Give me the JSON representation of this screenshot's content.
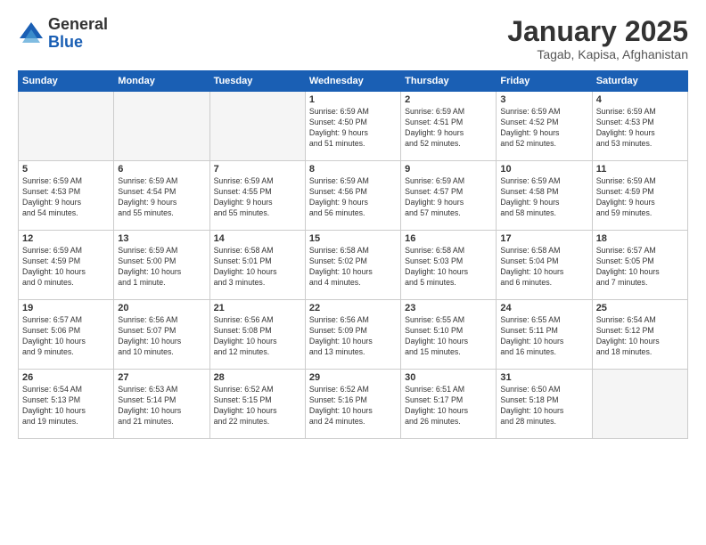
{
  "logo": {
    "general": "General",
    "blue": "Blue"
  },
  "title": "January 2025",
  "subtitle": "Tagab, Kapisa, Afghanistan",
  "days_of_week": [
    "Sunday",
    "Monday",
    "Tuesday",
    "Wednesday",
    "Thursday",
    "Friday",
    "Saturday"
  ],
  "weeks": [
    [
      {
        "day": "",
        "info": ""
      },
      {
        "day": "",
        "info": ""
      },
      {
        "day": "",
        "info": ""
      },
      {
        "day": "1",
        "info": "Sunrise: 6:59 AM\nSunset: 4:50 PM\nDaylight: 9 hours\nand 51 minutes."
      },
      {
        "day": "2",
        "info": "Sunrise: 6:59 AM\nSunset: 4:51 PM\nDaylight: 9 hours\nand 52 minutes."
      },
      {
        "day": "3",
        "info": "Sunrise: 6:59 AM\nSunset: 4:52 PM\nDaylight: 9 hours\nand 52 minutes."
      },
      {
        "day": "4",
        "info": "Sunrise: 6:59 AM\nSunset: 4:53 PM\nDaylight: 9 hours\nand 53 minutes."
      }
    ],
    [
      {
        "day": "5",
        "info": "Sunrise: 6:59 AM\nSunset: 4:53 PM\nDaylight: 9 hours\nand 54 minutes."
      },
      {
        "day": "6",
        "info": "Sunrise: 6:59 AM\nSunset: 4:54 PM\nDaylight: 9 hours\nand 55 minutes."
      },
      {
        "day": "7",
        "info": "Sunrise: 6:59 AM\nSunset: 4:55 PM\nDaylight: 9 hours\nand 55 minutes."
      },
      {
        "day": "8",
        "info": "Sunrise: 6:59 AM\nSunset: 4:56 PM\nDaylight: 9 hours\nand 56 minutes."
      },
      {
        "day": "9",
        "info": "Sunrise: 6:59 AM\nSunset: 4:57 PM\nDaylight: 9 hours\nand 57 minutes."
      },
      {
        "day": "10",
        "info": "Sunrise: 6:59 AM\nSunset: 4:58 PM\nDaylight: 9 hours\nand 58 minutes."
      },
      {
        "day": "11",
        "info": "Sunrise: 6:59 AM\nSunset: 4:59 PM\nDaylight: 9 hours\nand 59 minutes."
      }
    ],
    [
      {
        "day": "12",
        "info": "Sunrise: 6:59 AM\nSunset: 4:59 PM\nDaylight: 10 hours\nand 0 minutes."
      },
      {
        "day": "13",
        "info": "Sunrise: 6:59 AM\nSunset: 5:00 PM\nDaylight: 10 hours\nand 1 minute."
      },
      {
        "day": "14",
        "info": "Sunrise: 6:58 AM\nSunset: 5:01 PM\nDaylight: 10 hours\nand 3 minutes."
      },
      {
        "day": "15",
        "info": "Sunrise: 6:58 AM\nSunset: 5:02 PM\nDaylight: 10 hours\nand 4 minutes."
      },
      {
        "day": "16",
        "info": "Sunrise: 6:58 AM\nSunset: 5:03 PM\nDaylight: 10 hours\nand 5 minutes."
      },
      {
        "day": "17",
        "info": "Sunrise: 6:58 AM\nSunset: 5:04 PM\nDaylight: 10 hours\nand 6 minutes."
      },
      {
        "day": "18",
        "info": "Sunrise: 6:57 AM\nSunset: 5:05 PM\nDaylight: 10 hours\nand 7 minutes."
      }
    ],
    [
      {
        "day": "19",
        "info": "Sunrise: 6:57 AM\nSunset: 5:06 PM\nDaylight: 10 hours\nand 9 minutes."
      },
      {
        "day": "20",
        "info": "Sunrise: 6:56 AM\nSunset: 5:07 PM\nDaylight: 10 hours\nand 10 minutes."
      },
      {
        "day": "21",
        "info": "Sunrise: 6:56 AM\nSunset: 5:08 PM\nDaylight: 10 hours\nand 12 minutes."
      },
      {
        "day": "22",
        "info": "Sunrise: 6:56 AM\nSunset: 5:09 PM\nDaylight: 10 hours\nand 13 minutes."
      },
      {
        "day": "23",
        "info": "Sunrise: 6:55 AM\nSunset: 5:10 PM\nDaylight: 10 hours\nand 15 minutes."
      },
      {
        "day": "24",
        "info": "Sunrise: 6:55 AM\nSunset: 5:11 PM\nDaylight: 10 hours\nand 16 minutes."
      },
      {
        "day": "25",
        "info": "Sunrise: 6:54 AM\nSunset: 5:12 PM\nDaylight: 10 hours\nand 18 minutes."
      }
    ],
    [
      {
        "day": "26",
        "info": "Sunrise: 6:54 AM\nSunset: 5:13 PM\nDaylight: 10 hours\nand 19 minutes."
      },
      {
        "day": "27",
        "info": "Sunrise: 6:53 AM\nSunset: 5:14 PM\nDaylight: 10 hours\nand 21 minutes."
      },
      {
        "day": "28",
        "info": "Sunrise: 6:52 AM\nSunset: 5:15 PM\nDaylight: 10 hours\nand 22 minutes."
      },
      {
        "day": "29",
        "info": "Sunrise: 6:52 AM\nSunset: 5:16 PM\nDaylight: 10 hours\nand 24 minutes."
      },
      {
        "day": "30",
        "info": "Sunrise: 6:51 AM\nSunset: 5:17 PM\nDaylight: 10 hours\nand 26 minutes."
      },
      {
        "day": "31",
        "info": "Sunrise: 6:50 AM\nSunset: 5:18 PM\nDaylight: 10 hours\nand 28 minutes."
      },
      {
        "day": "",
        "info": ""
      }
    ]
  ]
}
